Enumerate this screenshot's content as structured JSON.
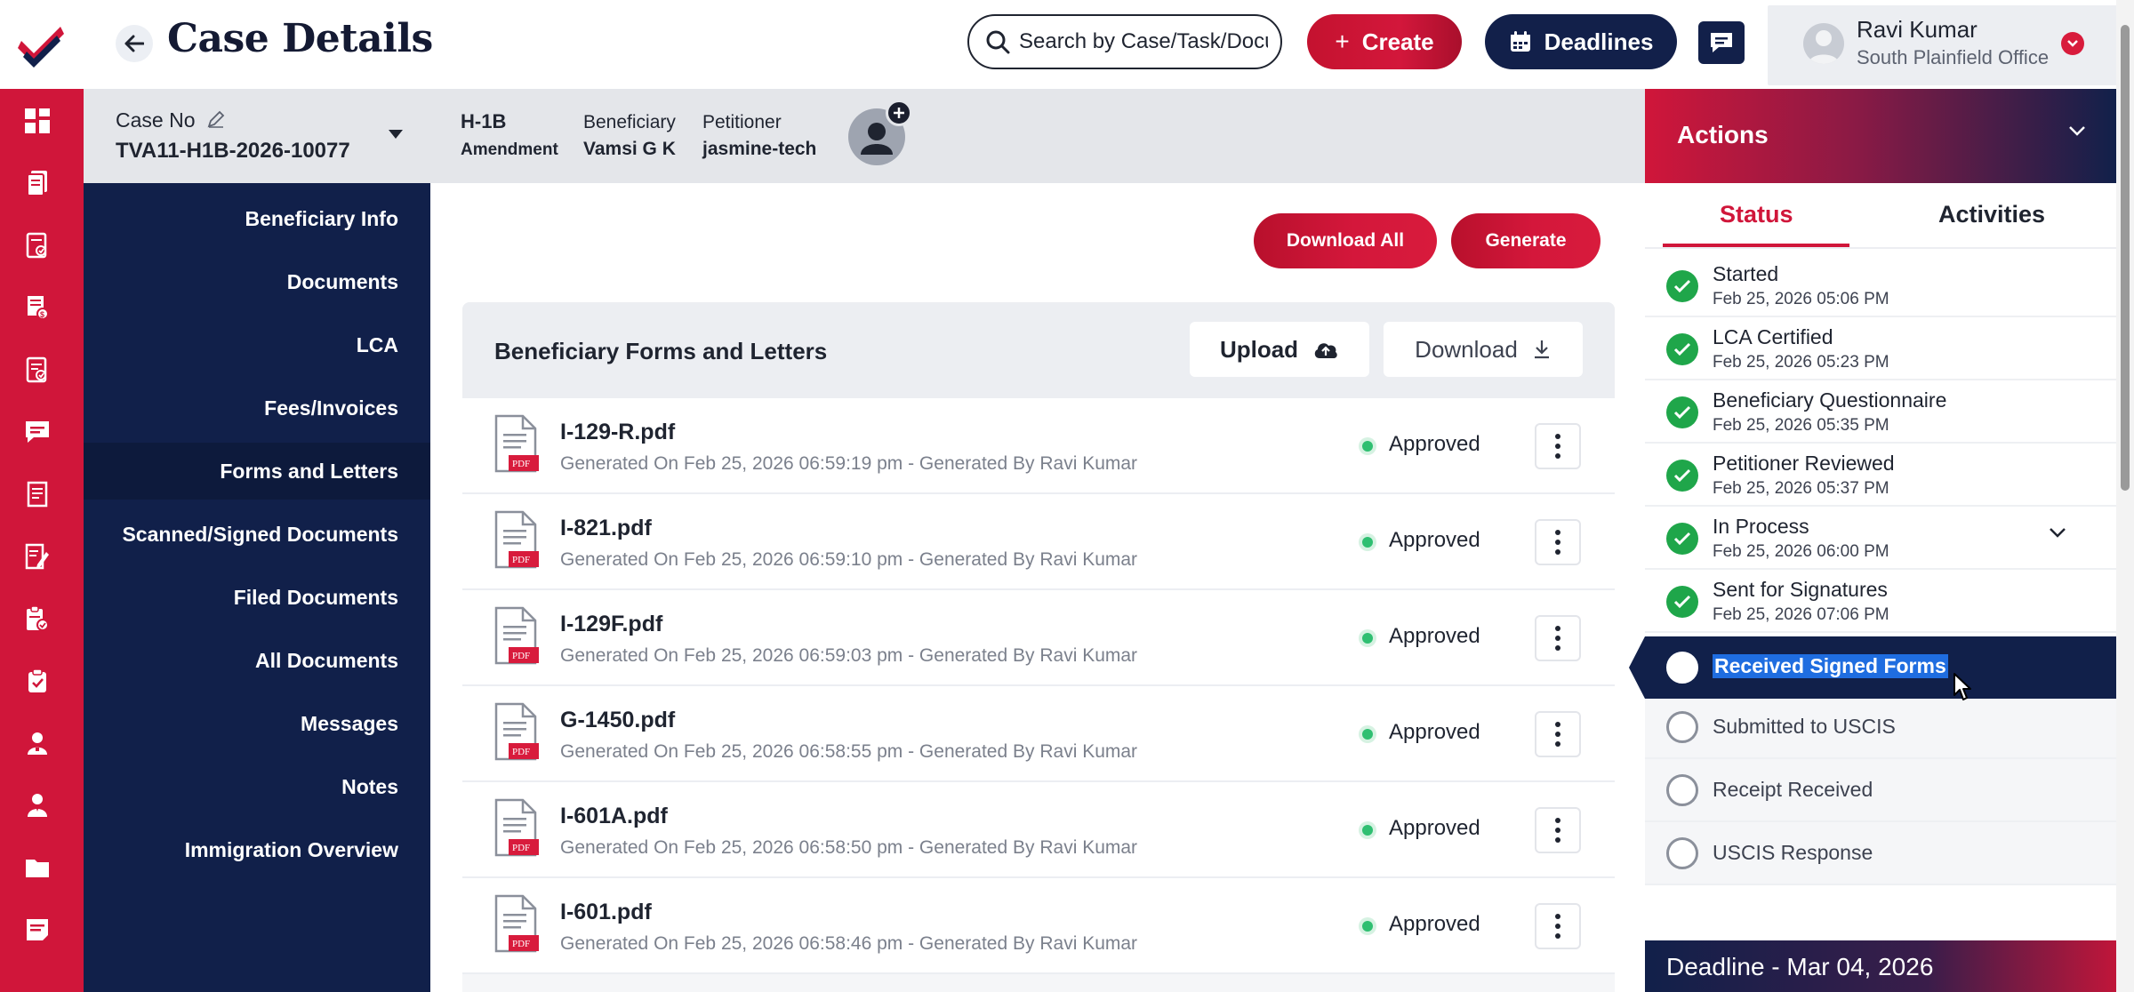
{
  "header": {
    "title": "Case Details",
    "search_placeholder": "Search by Case/Task/Document",
    "create_label": "Create",
    "deadlines_label": "Deadlines",
    "user_name": "Ravi Kumar",
    "user_office": "South Plainfield Office"
  },
  "case": {
    "case_no_label": "Case No",
    "case_no": "TVA11-H1B-2026-10077",
    "visa_type": "H-1B",
    "visa_subtype": "Amendment",
    "beneficiary_label": "Beneficiary",
    "beneficiary": "Vamsi G K",
    "petitioner_label": "Petitioner",
    "petitioner": "jasmine-tech"
  },
  "sidenav": {
    "items": [
      {
        "label": "Beneficiary Info"
      },
      {
        "label": "Documents"
      },
      {
        "label": "LCA"
      },
      {
        "label": "Fees/Invoices"
      },
      {
        "label": "Forms and Letters"
      },
      {
        "label": "Scanned/Signed Documents"
      },
      {
        "label": "Filed Documents"
      },
      {
        "label": "All Documents"
      },
      {
        "label": "Messages"
      },
      {
        "label": "Notes"
      },
      {
        "label": "Immigration Overview"
      }
    ],
    "active_index": 4
  },
  "rail": {
    "icons": [
      "dashboard-icon",
      "cases-icon",
      "tasks-icon",
      "invoices-icon",
      "reports-icon",
      "messages-icon",
      "library-icon",
      "forms-icon",
      "documents-icon",
      "checklist-icon",
      "beneficiary-icon",
      "users-icon",
      "folder-icon",
      "notes-icon"
    ]
  },
  "main": {
    "download_all_label": "Download All",
    "generate_label": "Generate",
    "forms_title": "Beneficiary Forms and Letters",
    "upload_label": "Upload",
    "download_label": "Download",
    "documents": [
      {
        "name": "I-129-R.pdf",
        "meta": "Generated On Feb 25, 2026 06:59:19 pm - Generated By Ravi Kumar",
        "status": "Approved"
      },
      {
        "name": "I-821.pdf",
        "meta": "Generated On Feb 25, 2026 06:59:10 pm - Generated By Ravi Kumar",
        "status": "Approved"
      },
      {
        "name": "I-129F.pdf",
        "meta": "Generated On Feb 25, 2026 06:59:03 pm - Generated By Ravi Kumar",
        "status": "Approved"
      },
      {
        "name": "G-1450.pdf",
        "meta": "Generated On Feb 25, 2026 06:58:55 pm - Generated By Ravi Kumar",
        "status": "Approved"
      },
      {
        "name": "I-601A.pdf",
        "meta": "Generated On Feb 25, 2026 06:58:50 pm - Generated By Ravi Kumar",
        "status": "Approved"
      },
      {
        "name": "I-601.pdf",
        "meta": "Generated On Feb 25, 2026 06:58:46 pm - Generated By Ravi Kumar",
        "status": "Approved"
      }
    ]
  },
  "actions": {
    "title": "Actions",
    "tab_status": "Status",
    "tab_activities": "Activities",
    "completed": [
      {
        "name": "Started",
        "date": "Feb 25, 2026 05:06 PM"
      },
      {
        "name": "LCA Certified",
        "date": "Feb 25, 2026 05:23 PM"
      },
      {
        "name": "Beneficiary Questionnaire",
        "date": "Feb 25, 2026 05:35 PM"
      },
      {
        "name": "Petitioner Reviewed",
        "date": "Feb 25, 2026 05:37 PM"
      },
      {
        "name": "In Process",
        "date": "Feb 25, 2026 06:00 PM"
      },
      {
        "name": "Sent for Signatures",
        "date": "Feb 25, 2026 07:06 PM"
      }
    ],
    "active_step": "Received Signed Forms",
    "pending": [
      "Submitted to USCIS",
      "Receipt Received",
      "USCIS Response"
    ],
    "deadline": "Deadline - Mar 04, 2026"
  },
  "colors": {
    "brand_red": "#d0163a",
    "navy": "#11204a",
    "success_green": "#1fa64a",
    "highlight_blue": "#1f6de0"
  }
}
